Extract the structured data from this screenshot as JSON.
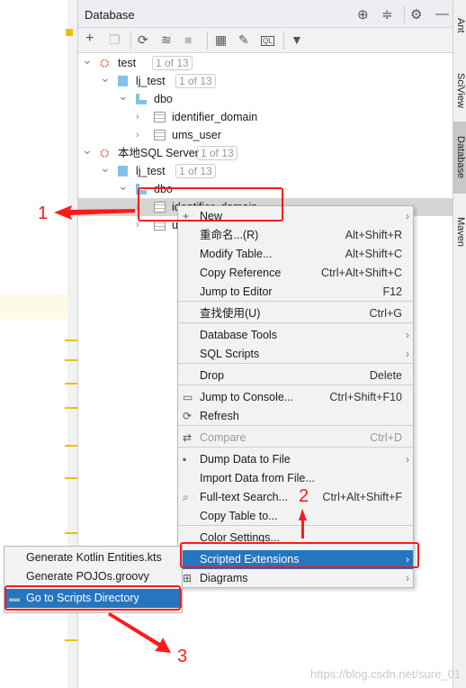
{
  "panel": {
    "title": "Database"
  },
  "header_icons": [
    "crosshair-icon",
    "collapse-icon",
    "gear-icon",
    "minimize-icon"
  ],
  "toolbar_icons": [
    "add-icon",
    "duplicate-icon",
    "refresh-icon",
    "schema-icon",
    "stop-icon",
    "table-icon",
    "edit-icon",
    "console-icon",
    "filter-icon"
  ],
  "tree": [
    {
      "label": "test",
      "badge": "1 of 13"
    },
    {
      "label": "lj_test",
      "badge": "1 of 13"
    },
    {
      "label": "dbo"
    },
    {
      "label": "identifier_domain"
    },
    {
      "label": "ums_user"
    },
    {
      "label": "本地SQL Server",
      "badge": "1 of 13"
    },
    {
      "label": "lj_test",
      "badge": "1 of 13"
    },
    {
      "label": "dbo"
    },
    {
      "label": "identifier_domain"
    },
    {
      "label": "ums_user"
    }
  ],
  "side_tabs": [
    "Ant",
    "SciView",
    "Database",
    "Maven"
  ],
  "menu": [
    {
      "label": "New",
      "shortcut": ""
    },
    {
      "label": "重命名...(R)",
      "shortcut": "Alt+Shift+R"
    },
    {
      "label": "Modify Table...",
      "shortcut": "Alt+Shift+C"
    },
    {
      "label": "Copy Reference",
      "shortcut": "Ctrl+Alt+Shift+C"
    },
    {
      "label": "Jump to Editor",
      "shortcut": "F12"
    },
    {
      "label": "查找使用(U)",
      "shortcut": "Ctrl+G"
    },
    {
      "label": "Database Tools",
      "shortcut": ""
    },
    {
      "label": "SQL Scripts",
      "shortcut": ""
    },
    {
      "label": "Drop",
      "shortcut": "Delete"
    },
    {
      "label": "Jump to Console...",
      "shortcut": "Ctrl+Shift+F10"
    },
    {
      "label": "Refresh",
      "shortcut": ""
    },
    {
      "label": "Compare",
      "shortcut": "Ctrl+D"
    },
    {
      "label": "Dump Data to File",
      "shortcut": ""
    },
    {
      "label": "Import Data from File...",
      "shortcut": ""
    },
    {
      "label": "Full-text Search...",
      "shortcut": "Ctrl+Alt+Shift+F"
    },
    {
      "label": "Copy Table to...",
      "shortcut": ""
    },
    {
      "label": "Color Settings...",
      "shortcut": ""
    },
    {
      "label": "Scripted Extensions",
      "shortcut": ""
    },
    {
      "label": "Diagrams",
      "shortcut": ""
    }
  ],
  "submenu": [
    {
      "label": "Generate Kotlin Entities.kts"
    },
    {
      "label": "Generate POJOs.groovy"
    },
    {
      "label": "Go to Scripts Directory"
    }
  ],
  "annotations": {
    "n1": "1",
    "n2": "2",
    "n3": "3",
    "color": "#ff1a1a"
  },
  "watermark": "https://blog.csdn.net/sure_01",
  "colors": {
    "selection": "#2675bf"
  }
}
